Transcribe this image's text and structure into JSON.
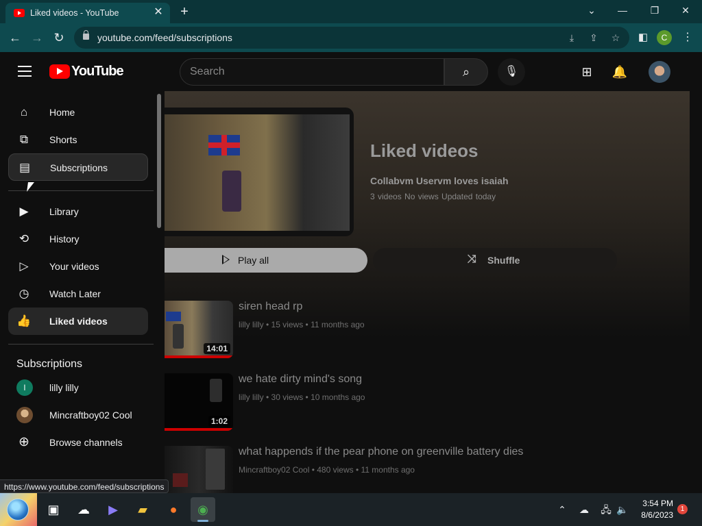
{
  "browser": {
    "tab_title": "Liked videos - YouTube",
    "url": "youtube.com/feed/subscriptions",
    "profile_initial": "C",
    "status_url": "https://www.youtube.com/feed/subscriptions"
  },
  "masthead": {
    "logo_text": "YouTube",
    "search_placeholder": "Search"
  },
  "sidebar": {
    "items": [
      {
        "label": "Home",
        "icon": "home-icon"
      },
      {
        "label": "Shorts",
        "icon": "shorts-icon"
      },
      {
        "label": "Subscriptions",
        "icon": "subscriptions-icon"
      },
      {
        "label": "Library",
        "icon": "library-icon"
      },
      {
        "label": "History",
        "icon": "history-icon"
      },
      {
        "label": "Your videos",
        "icon": "your-videos-icon"
      },
      {
        "label": "Watch Later",
        "icon": "watch-later-icon"
      },
      {
        "label": "Liked videos",
        "icon": "thumbs-up-icon"
      }
    ],
    "subscriptions_heading": "Subscriptions",
    "subscriptions": [
      {
        "name": "lilly lilly",
        "initial": "l"
      },
      {
        "name": "Mincraftboy02 Cool"
      },
      {
        "name": "Browse channels"
      }
    ]
  },
  "playlist": {
    "title": "Liked videos",
    "owner": "Collabvm Uservm loves isaiah",
    "meta": "3 videos   No views   Updated today",
    "play_all": "Play all",
    "shuffle": "Shuffle"
  },
  "videos": [
    {
      "title": "siren head rp",
      "meta": "lilly lilly • 15 views • 11 months ago",
      "duration": "14:01"
    },
    {
      "title": "we hate dirty mind's song",
      "meta": "lilly lilly • 30 views • 10 months ago",
      "duration": "1:02"
    },
    {
      "title": "what happends if the pear phone on greenville battery dies",
      "meta": "Mincraftboy02 Cool • 480 views • 11 months ago",
      "duration": ""
    }
  ],
  "taskbar": {
    "time": "3:54 PM",
    "date": "8/6/2023",
    "notification_count": "1"
  },
  "colors": {
    "accent_red": "#ff0000",
    "browser_teal": "#0e4a4f",
    "page_bg": "#0f0f0f"
  }
}
